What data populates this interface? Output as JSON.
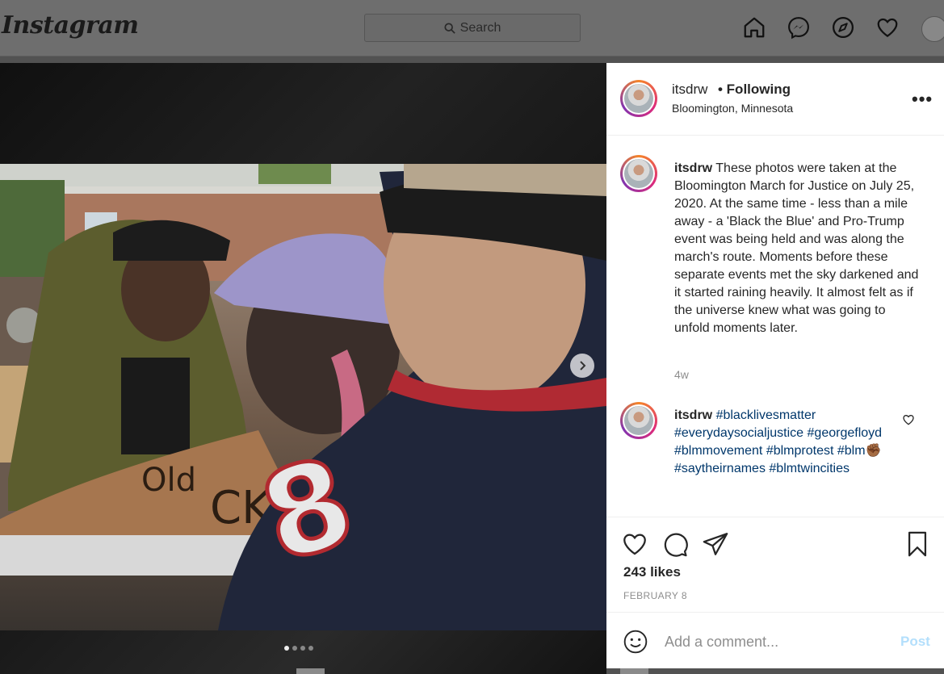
{
  "header": {
    "logo": "Instagram",
    "search_placeholder": "Search",
    "icons": [
      "home-icon",
      "messenger-icon",
      "explore-icon",
      "heart-icon",
      "avatar"
    ]
  },
  "post": {
    "image_alt": "Photo of protesters at the Bloomington March for Justice",
    "carousel": {
      "count": 4,
      "active": 1
    },
    "author": "itsdrw",
    "follow_status": "• Following",
    "location": "Bloomington, Minnesota",
    "caption": {
      "username": "itsdrw",
      "text": "These photos were taken at the Bloomington March for Justice on July 25, 2020. At the same time - less than a mile away - a 'Black the Blue' and Pro-Trump event was being held and was along the march's route. Moments before these separate events met the sky darkened and it started raining heavily. It almost felt as if the universe knew what was going to unfold moments later.",
      "time": "4w"
    },
    "comment": {
      "username": "itsdrw",
      "hashtags": [
        "#blacklivesmatter",
        "#everydaysocialjustice",
        "#georgefloyd",
        "#blmmovement",
        "#blmprotest",
        "#blm",
        "#saytheirnames",
        "#blmtwincities"
      ],
      "emoji": "✊🏾"
    },
    "likes": "243 likes",
    "date": "FEBRUARY 8",
    "add_comment_placeholder": "Add a comment...",
    "post_button": "Post"
  }
}
